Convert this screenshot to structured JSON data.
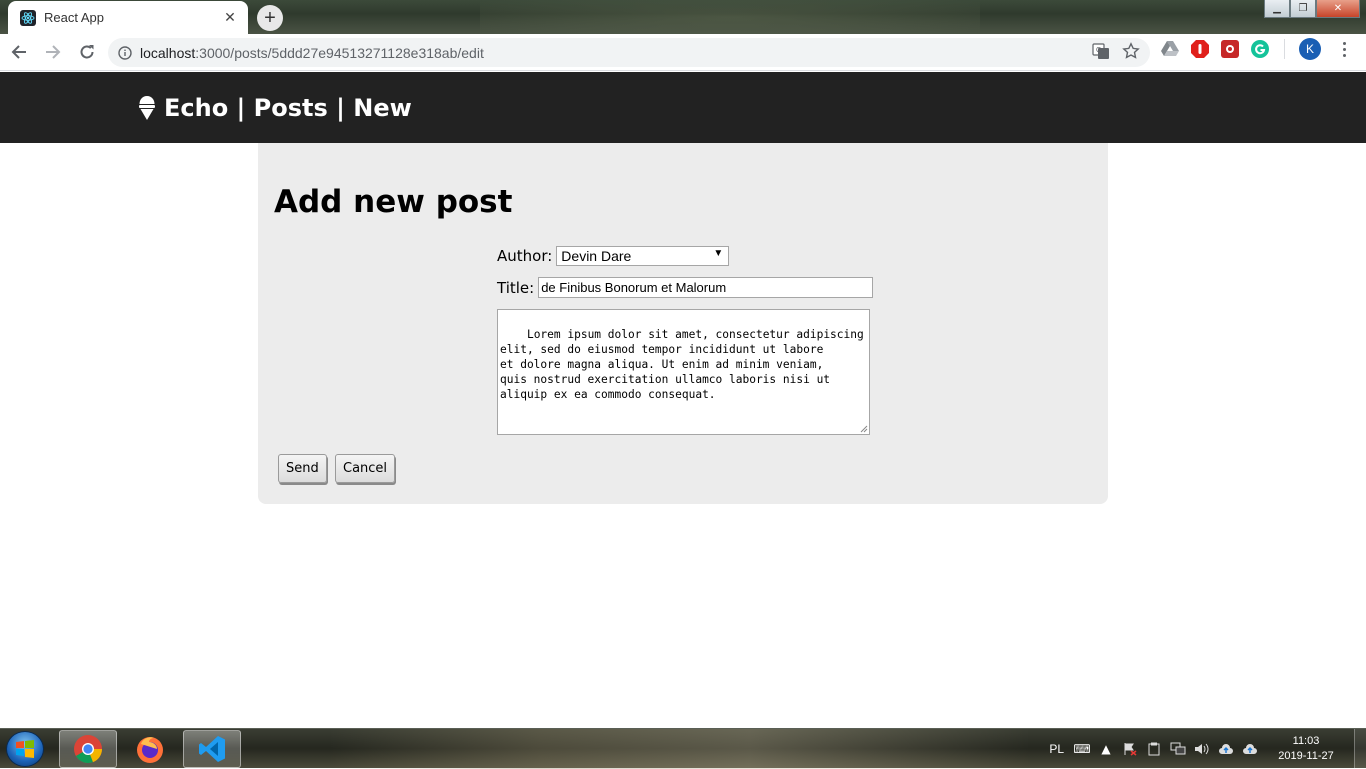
{
  "browser": {
    "tab_title": "React App",
    "tab_close": "✕",
    "new_tab": "+",
    "url_host": "localhost",
    "url_rest": ":3000/posts/5ddd27e94513271128e318ab/edit",
    "profile_initial": "K",
    "window_controls": {
      "minimize": "▁",
      "maximize": "❐",
      "close": "✕"
    }
  },
  "header": {
    "brand": "Echo | Posts | New"
  },
  "form": {
    "title": "Add new post",
    "author_label": "Author:",
    "author_value": "Devin Dare",
    "title_label": "Title:",
    "title_value": "de Finibus Bonorum et Malorum",
    "body_value": "Lorem ipsum dolor sit amet, consectetur adipiscing\nelit, sed do eiusmod tempor incididunt ut labore\net dolore magna aliqua. Ut enim ad minim veniam,\nquis nostrud exercitation ullamco laboris nisi ut\naliquip ex ea commodo consequat.",
    "send_label": "Send",
    "cancel_label": "Cancel"
  },
  "taskbar": {
    "apps": [
      "chrome-icon",
      "firefox-icon",
      "vscode-icon"
    ],
    "lang": "PL",
    "time": "11:03",
    "date": "2019-11-27"
  },
  "colors": {
    "header_bg": "#222222",
    "panel_bg": "#ececec",
    "toolbar_bg": "#ffffff"
  }
}
